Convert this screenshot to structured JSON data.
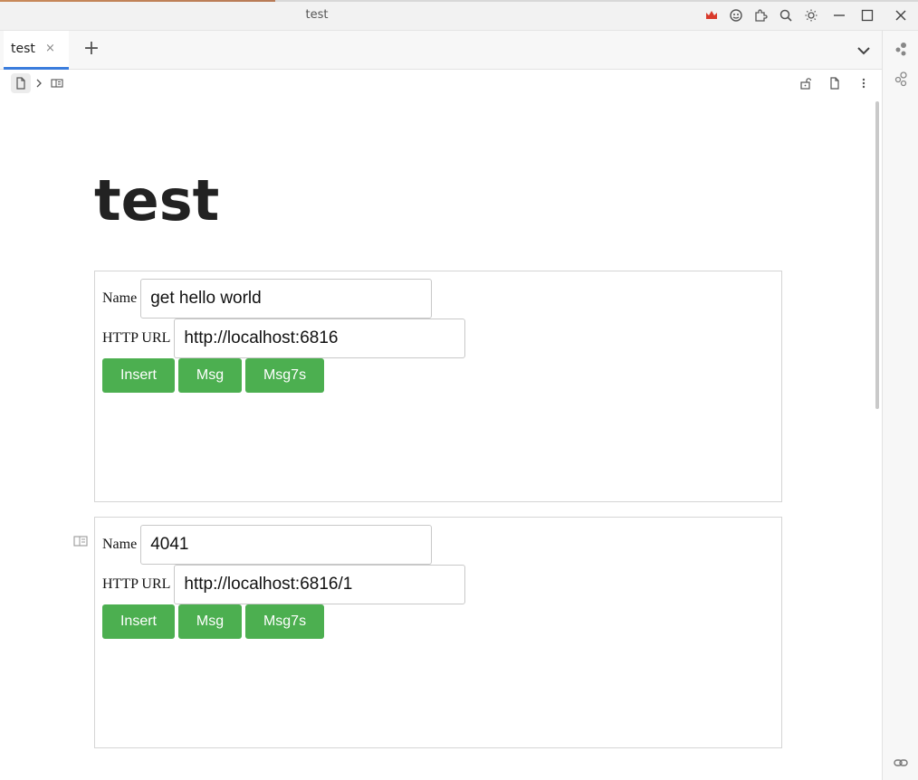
{
  "window": {
    "title": "test",
    "icons": [
      "crown-icon",
      "face-icon",
      "puzzle-icon",
      "search-icon",
      "sun-icon",
      "minimize-icon",
      "maximize-icon",
      "close-icon"
    ],
    "crown_color": "#d93a2b"
  },
  "tabs": [
    {
      "label": "test",
      "close": "×",
      "active": true
    }
  ],
  "tab_add": "+",
  "doc": {
    "title": "test"
  },
  "widgets": [
    {
      "name_label": "Name",
      "name_value": "get hello world",
      "url_label": "HTTP URL",
      "url_value": "http://localhost:6816",
      "buttons": [
        "Insert",
        "Msg",
        "Msg7s"
      ]
    },
    {
      "name_label": "Name",
      "name_value": "4041",
      "url_label": "HTTP URL",
      "url_value": "http://localhost:6816/1",
      "buttons": [
        "Insert",
        "Msg",
        "Msg7s"
      ]
    }
  ],
  "colors": {
    "accent": "#3b7ddd",
    "button_green": "#4caf50"
  }
}
